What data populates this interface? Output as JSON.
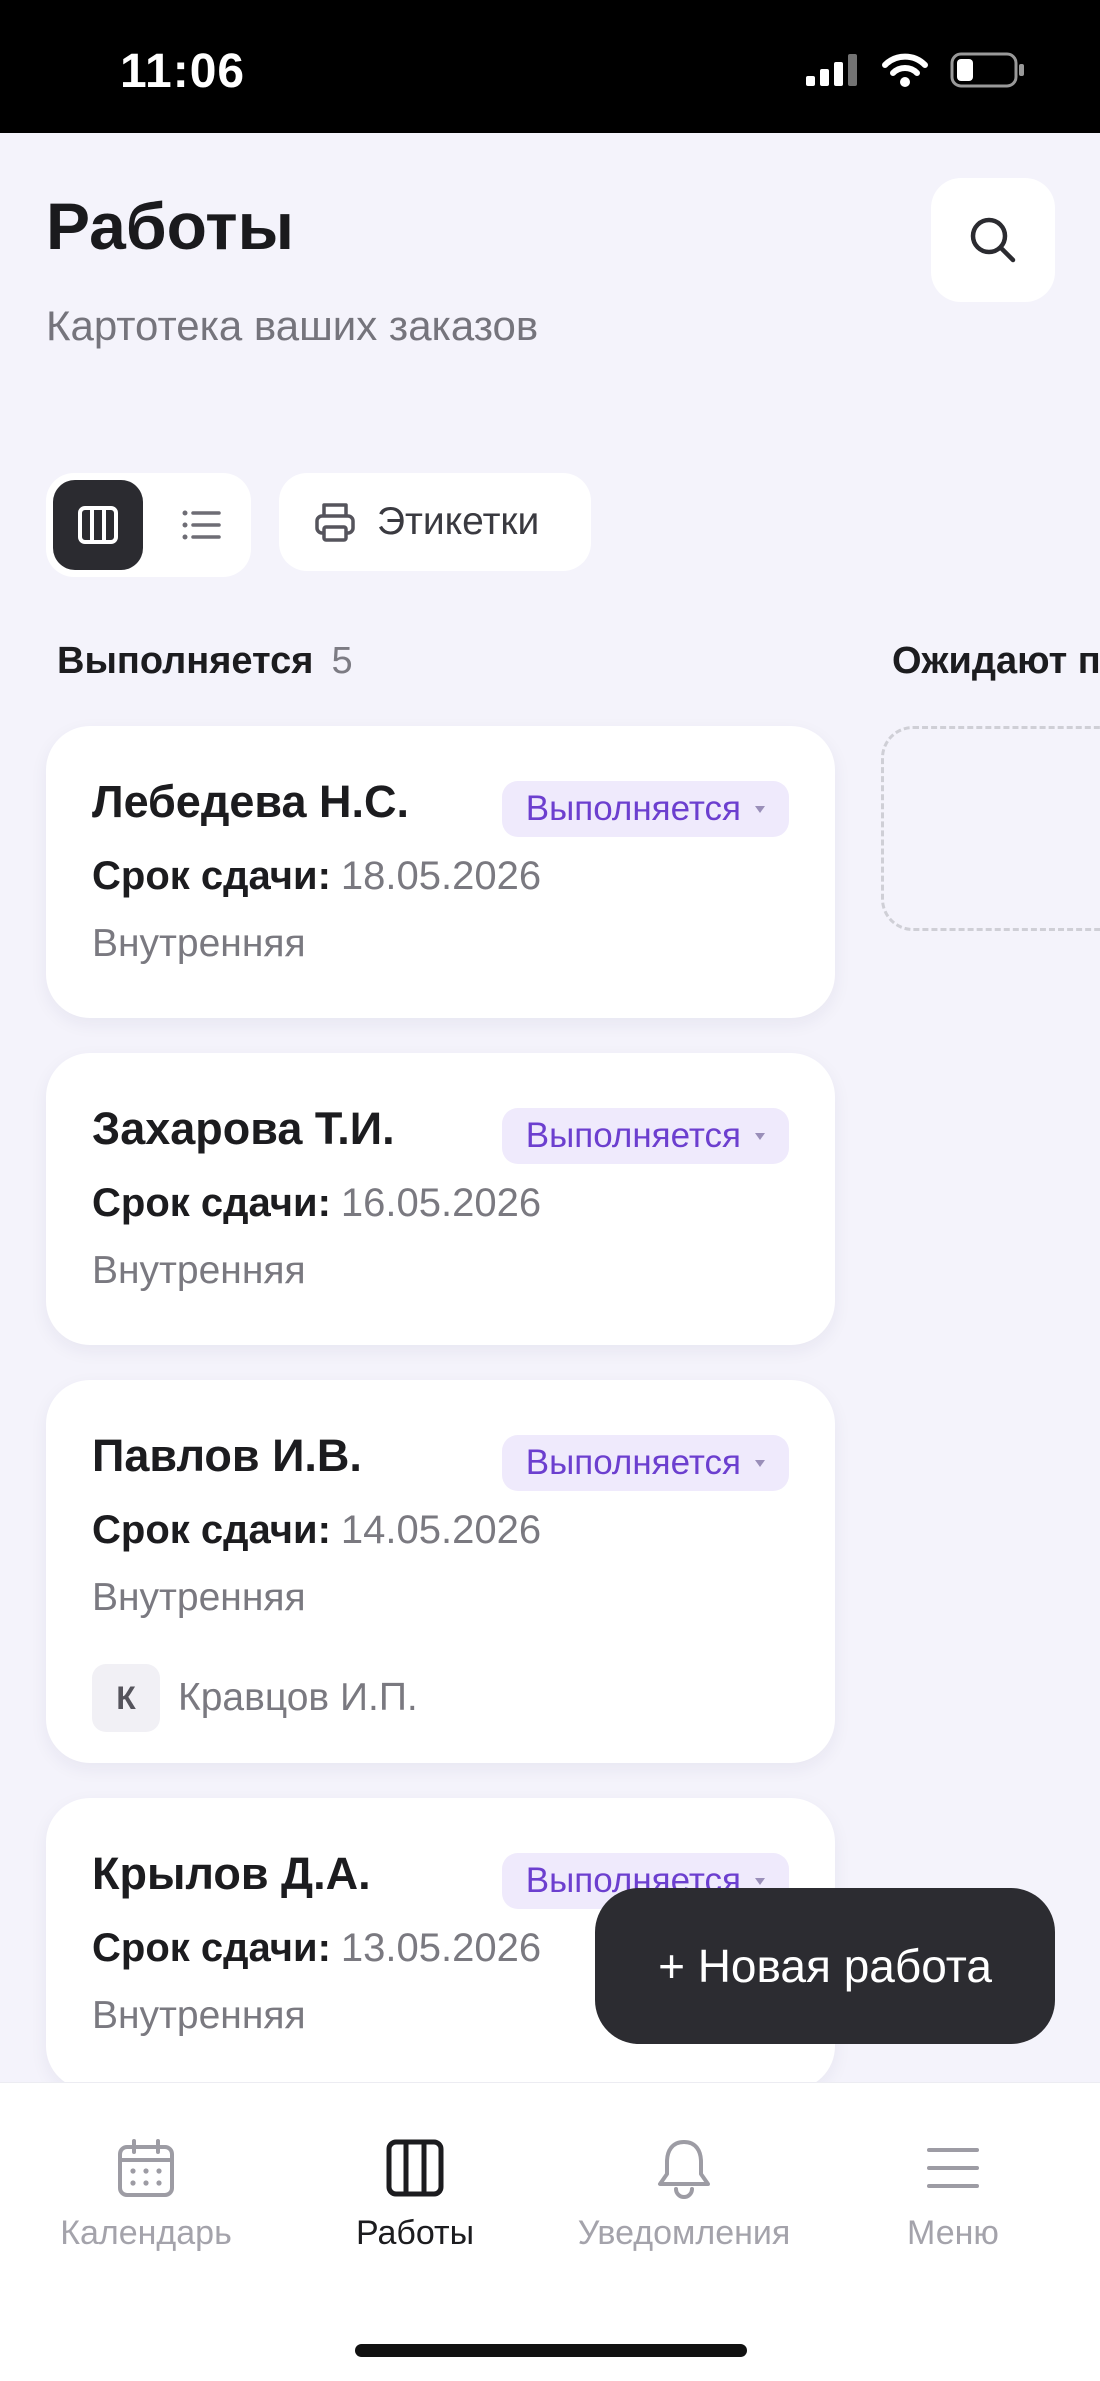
{
  "status_bar": {
    "time": "11:06"
  },
  "header": {
    "title": "Работы",
    "subtitle": "Картотека ваших заказов"
  },
  "toolbar": {
    "labels_button": "Этикетки"
  },
  "columns": [
    {
      "title": "Выполняется",
      "count": "5"
    },
    {
      "title": "Ожидают п",
      "count": ""
    }
  ],
  "cards": [
    {
      "name": "Лебедева Н.С.",
      "status": "Выполняется",
      "due_label": "Срок сдачи:",
      "due_date": "18.05.2026",
      "type": "Внутренняя"
    },
    {
      "name": "Захарова Т.И.",
      "status": "Выполняется",
      "due_label": "Срок сдачи:",
      "due_date": "16.05.2026",
      "type": "Внутренняя"
    },
    {
      "name": "Павлов И.В.",
      "status": "Выполняется",
      "due_label": "Срок сдачи:",
      "due_date": "14.05.2026",
      "type": "Внутренняя",
      "assignee_initial": "К",
      "assignee": "Кравцов И.П."
    },
    {
      "name": "Крылов Д.А.",
      "status": "Выполняется",
      "due_label": "Срок сдачи:",
      "due_date": "13.05.2026",
      "type": "Внутренняя"
    }
  ],
  "fab": {
    "label": "+ Новая работа"
  },
  "bottom_nav": [
    {
      "label": "Календарь",
      "icon": "calendar-icon"
    },
    {
      "label": "Работы",
      "icon": "kanban-icon",
      "active": true
    },
    {
      "label": "Уведомления",
      "icon": "bell-icon"
    },
    {
      "label": "Меню",
      "icon": "menu-icon"
    }
  ],
  "colors": {
    "accent": "#6c3fcf",
    "badge_bg": "#efeafc",
    "dark": "#2c2c31",
    "background": "#f4f3fb"
  }
}
